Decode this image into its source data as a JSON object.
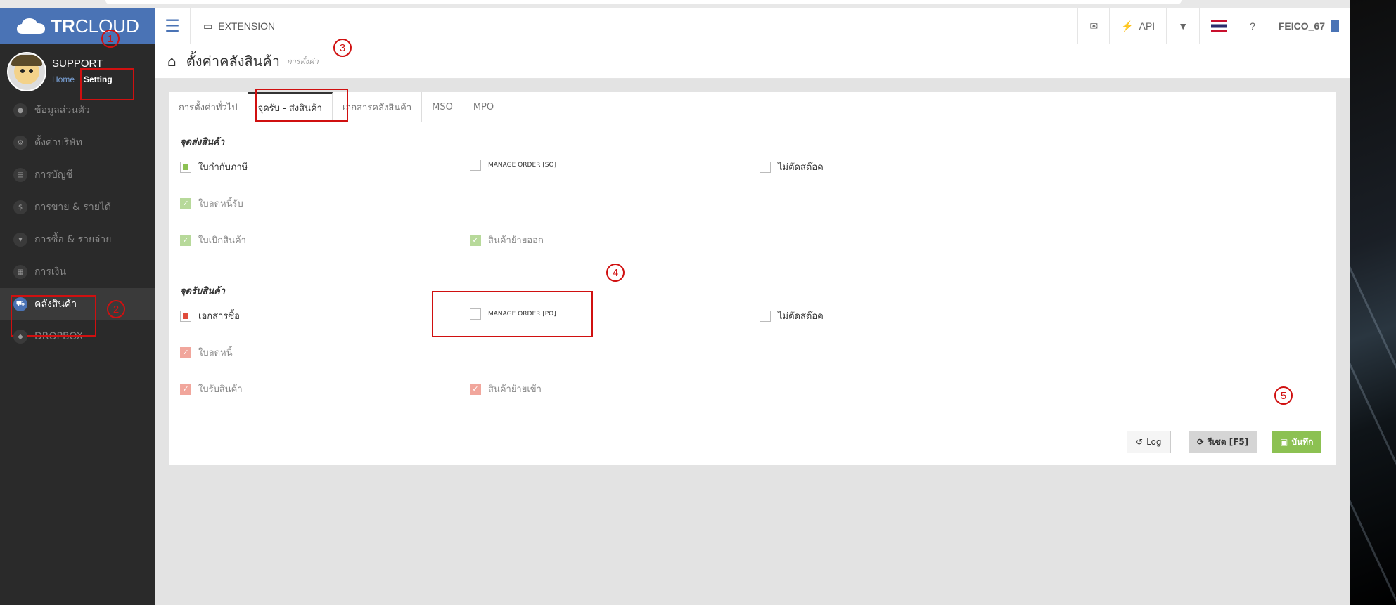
{
  "logo": {
    "bold": "TR",
    "light": "CLOUD"
  },
  "profile": {
    "name": "SUPPORT",
    "home": "Home",
    "setting": "Setting"
  },
  "sidebar": {
    "items": [
      {
        "icon": "user-icon",
        "glyph": "●",
        "label": "ข้อมูลส่วนตัว"
      },
      {
        "icon": "gear-icon",
        "glyph": "⚙",
        "label": "ตั้งค่าบริษัท"
      },
      {
        "icon": "book-icon",
        "glyph": "▤",
        "label": "การบัญชี"
      },
      {
        "icon": "dollar-icon",
        "glyph": "$",
        "label": "การขาย & รายได้"
      },
      {
        "icon": "cart-icon",
        "glyph": "▾",
        "label": "การซื้อ & รายจ่าย"
      },
      {
        "icon": "calendar-icon",
        "glyph": "▦",
        "label": "การเงิน"
      },
      {
        "icon": "truck-icon",
        "glyph": "⛟",
        "label": "คลังสินค้า",
        "active": true
      },
      {
        "icon": "dropbox-icon",
        "glyph": "◆",
        "label": "DROPBOX"
      }
    ]
  },
  "header": {
    "extension": "EXTENSION",
    "api": "API",
    "user": "FEICO_67"
  },
  "title": {
    "main": "ตั้งค่าคลังสินค้า",
    "sub": "การตั้งค่า"
  },
  "tabs": [
    "การตั้งค่าทั่วไป",
    "จุดรับ - ส่งสินค้า",
    "เอกสารคลังสินค้า",
    "MSO",
    "MPO"
  ],
  "active_tab": 1,
  "ship": {
    "title": "จุดส่งสินค้า",
    "tax_invoice": "ใบกำกับภาษี",
    "manage_so": "MANAGE ORDER [SO]",
    "no_cut_stock": "ไม่ตัดสต๊อค",
    "credit_note": "ใบลดหนี้รับ",
    "withdraw": "ใบเบิกสินค้า",
    "transfer_out": "สินค้าย้ายออก"
  },
  "receive": {
    "title": "จุดรับสินค้า",
    "purchase_doc": "เอกสารซื้อ",
    "manage_po": "MANAGE ORDER [PO]",
    "no_cut_stock": "ไม่ตัดสต๊อค",
    "debit_note": "ใบลดหนี้",
    "receipt": "ใบรับสินค้า",
    "transfer_in": "สินค้าย้ายเข้า"
  },
  "buttons": {
    "log": "Log",
    "reset": "รีเซต [F5]",
    "save": "บันทึก"
  },
  "annotations": [
    "1",
    "2",
    "3",
    "4",
    "5"
  ],
  "colors": {
    "brand": "#4a73b5",
    "success": "#8cc152",
    "danger": "#e04b3b",
    "annotation": "#d01010"
  }
}
